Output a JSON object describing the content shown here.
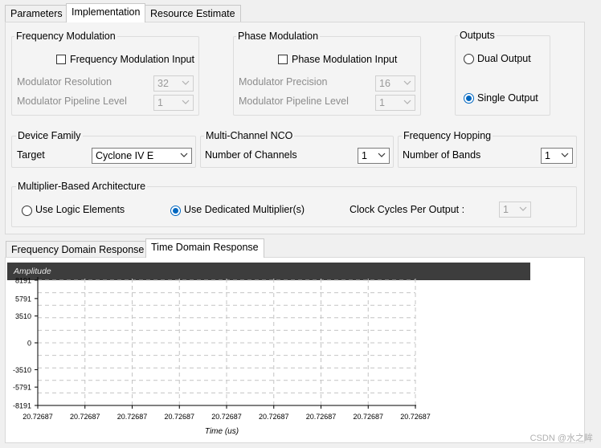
{
  "top_tabs": [
    "Parameters",
    "Implementation",
    "Resource Estimate"
  ],
  "freq_mod": {
    "title": "Frequency Modulation",
    "checkbox_label": "Frequency Modulation Input",
    "resolution_label": "Modulator Resolution",
    "resolution_value": "32",
    "pipeline_label": "Modulator Pipeline Level",
    "pipeline_value": "1"
  },
  "phase_mod": {
    "title": "Phase Modulation",
    "checkbox_label": "Phase Modulation Input",
    "precision_label": "Modulator Precision",
    "precision_value": "16",
    "pipeline_label": "Modulator Pipeline Level",
    "pipeline_value": "1"
  },
  "outputs": {
    "title": "Outputs",
    "dual": "Dual Output",
    "single": "Single Output",
    "selected": "Single Output"
  },
  "device": {
    "title": "Device Family",
    "target_label": "Target",
    "target_value": "Cyclone IV E"
  },
  "multichannel": {
    "title": "Multi-Channel NCO",
    "label": "Number of Channels",
    "value": "1"
  },
  "hopping": {
    "title": "Frequency Hopping",
    "label": "Number of Bands",
    "value": "1"
  },
  "multiplier": {
    "title": "Multiplier-Based Architecture",
    "logic": "Use Logic Elements",
    "dedicated": "Use Dedicated Multiplier(s)",
    "selected": "Use Dedicated Multiplier(s)",
    "clock_label": "Clock Cycles Per Output :",
    "clock_value": "1"
  },
  "bottom_tabs": [
    "Frequency Domain Response",
    "Time Domain Response"
  ],
  "watermark": "CSDN @水之眸",
  "chart_data": {
    "type": "line",
    "ylabel": "Amplitude",
    "xlabel": "Time (us)",
    "y_ticks": [
      "8191",
      "5791",
      "3510",
      "0",
      "-3510",
      "-5791",
      "-8191"
    ],
    "x_ticks": [
      "20.72687",
      "20.72687",
      "20.72687",
      "20.72687",
      "20.72687",
      "20.72687",
      "20.72687",
      "20.72687",
      "20.72687"
    ],
    "ylim": [
      -8191,
      8191
    ],
    "grid": true,
    "series": []
  }
}
